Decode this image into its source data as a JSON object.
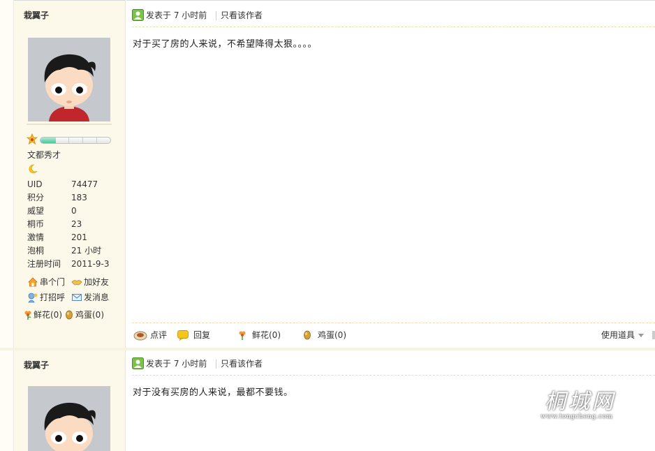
{
  "posts": [
    {
      "author": "栽翼子",
      "rank_title": "文都秀才",
      "level_progress": 0.22,
      "stats": [
        {
          "label": "UID",
          "value": "74477"
        },
        {
          "label": "积分",
          "value": "183"
        },
        {
          "label": "威望",
          "value": "0"
        },
        {
          "label": "桐币",
          "value": "23"
        },
        {
          "label": "激情",
          "value": "201"
        },
        {
          "label": "泡桐",
          "value": "21 小时"
        },
        {
          "label": "注册时间",
          "value": "2011-9-3"
        }
      ],
      "actions": {
        "visit": "串个门",
        "add_friend": "加好友",
        "greet": "打招呼",
        "message": "发消息"
      },
      "gifts": {
        "flowers": "鲜花(0)",
        "eggs": "鸡蛋(0)"
      },
      "posted_time": "发表于 7 小时前",
      "only_author": "只看该作者",
      "message": "对于买了房的人来说，不希望降得太狠。。。。",
      "footer": {
        "comment": "点评",
        "reply": "回复",
        "flowers": "鲜花(0)",
        "eggs": "鸡蛋(0)",
        "tools": "使用道具"
      }
    },
    {
      "author": "栽翼子",
      "posted_time": "发表于 7 小时前",
      "only_author": "只看该作者",
      "message": "对于没有买房的人来说，最都不要钱。"
    }
  ],
  "watermark": {
    "text": "桐城网",
    "url": "www.tongcheng.com"
  },
  "colors": {
    "sidebar_bg": "#fdf9ea",
    "dash": "#f0dca8",
    "level_fill": "#4fc79b"
  }
}
